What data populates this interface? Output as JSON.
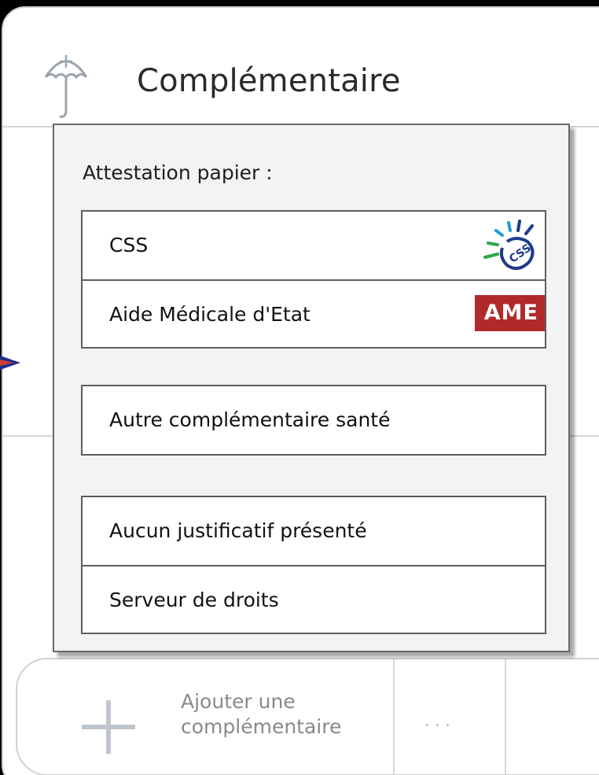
{
  "card": {
    "title": "Complémentaire",
    "icon": "umbrella-plus-icon"
  },
  "bottom_bar": {
    "add_label": "Ajouter une complémentaire",
    "more_label": "..."
  },
  "popup": {
    "title": "Attestation papier :",
    "groups": [
      {
        "options": [
          {
            "label": "CSS",
            "badge": "CSS"
          },
          {
            "label": "Aide Médicale d'Etat",
            "badge": "AME"
          }
        ]
      },
      {
        "options": [
          {
            "label": "Autre complémentaire santé"
          }
        ]
      },
      {
        "options": [
          {
            "label": "Aucun justificatif présenté"
          },
          {
            "label": "Serveur de droits"
          }
        ]
      }
    ]
  },
  "colors": {
    "ame_badge": "#b02a2a",
    "css_logo_blue": "#1e3a8a",
    "css_logo_green": "#2aa84a",
    "css_logo_cyan": "#1aa0d8",
    "plus_icon": "#bfc5cc"
  }
}
